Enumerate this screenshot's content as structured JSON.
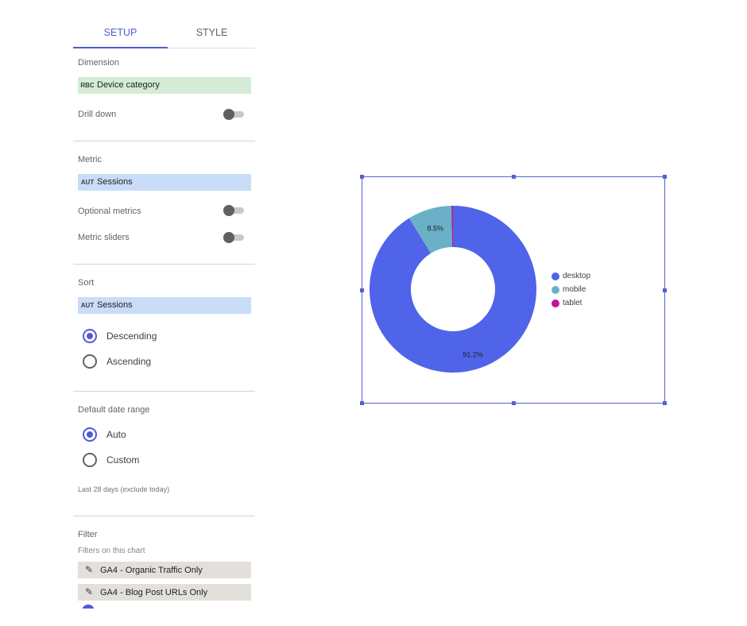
{
  "tabs": {
    "setup": "SETUP",
    "style": "STYLE"
  },
  "dimension": {
    "label": "Dimension",
    "tag": "RBC",
    "field": "Device category",
    "drill_down": "Drill down"
  },
  "metric": {
    "label": "Metric",
    "tag": "AUT",
    "field": "Sessions",
    "optional_metrics": "Optional metrics",
    "metric_sliders": "Metric sliders"
  },
  "sort": {
    "label": "Sort",
    "tag": "AUT",
    "field": "Sessions",
    "descending": "Descending",
    "ascending": "Ascending",
    "selected": "Descending"
  },
  "date_range": {
    "label": "Default date range",
    "auto": "Auto",
    "custom": "Custom",
    "note": "Last 28 days (exclude today)",
    "selected": "Auto"
  },
  "filter": {
    "label": "Filter",
    "sub": "Filters on this chart",
    "items": [
      "GA4 - Organic Traffic Only",
      "GA4 - Blog Post URLs Only"
    ]
  },
  "icons": {
    "pencil": "edit-icon"
  },
  "colors": {
    "accent": "#4f5bd5",
    "desktop": "#4f64e8",
    "mobile": "#6ab1c8",
    "tablet": "#c0139a"
  },
  "chart_data": {
    "type": "pie",
    "donut": true,
    "categories": [
      "desktop",
      "mobile",
      "tablet"
    ],
    "values": [
      91.2,
      8.5,
      0.3
    ],
    "labels": [
      "91.2%",
      "8.5%",
      ""
    ],
    "legend_position": "right"
  }
}
